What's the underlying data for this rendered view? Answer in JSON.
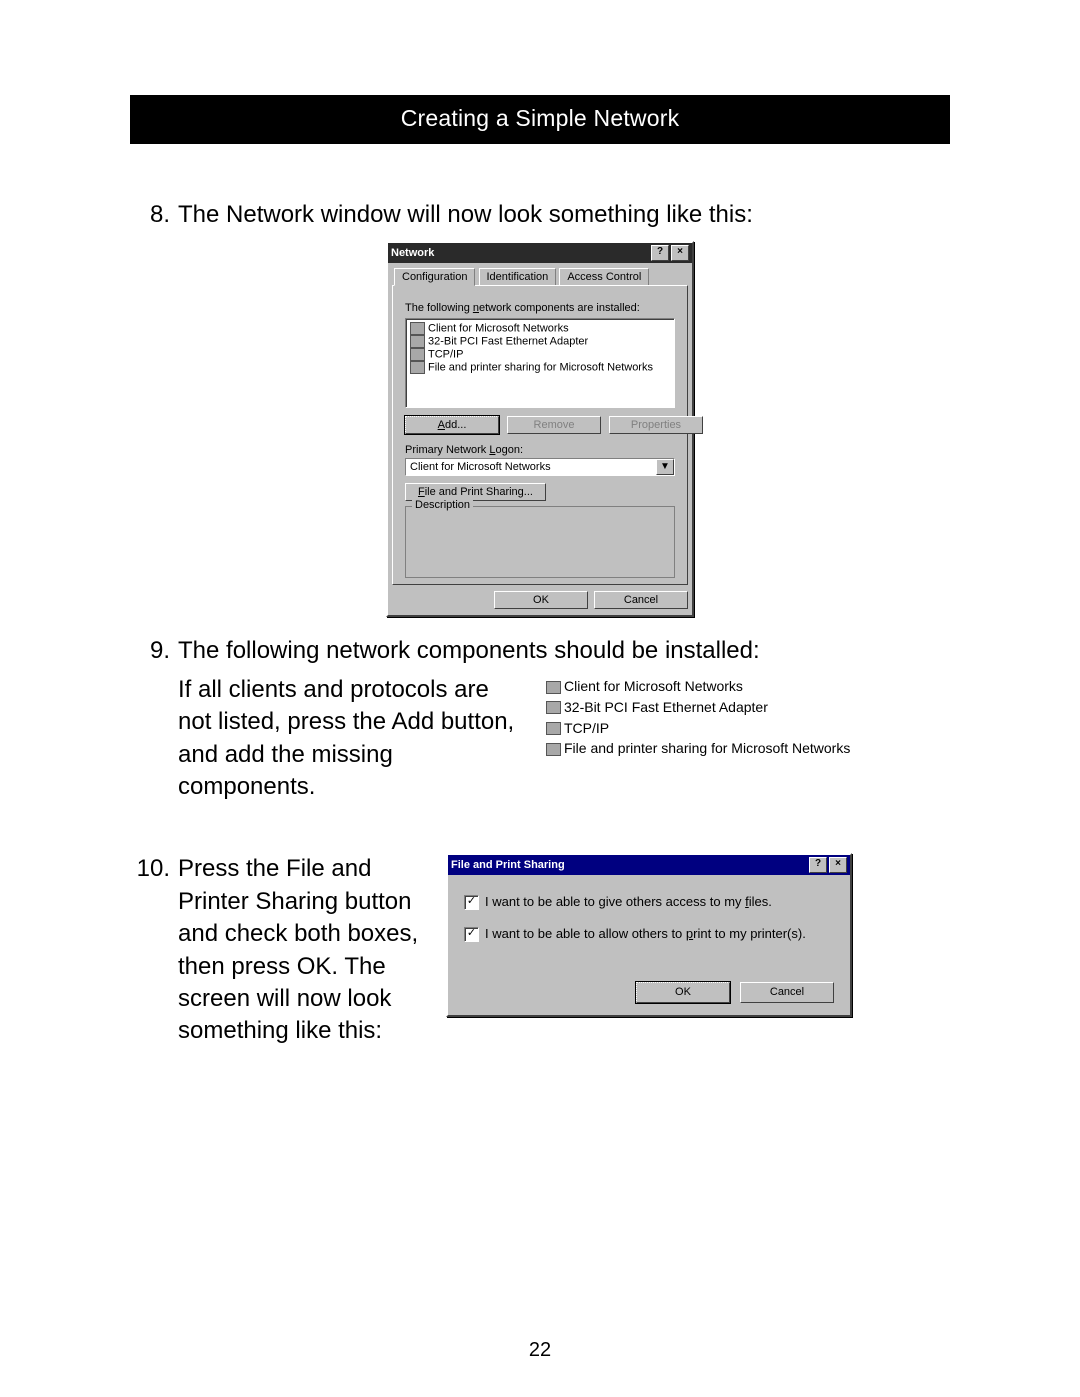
{
  "header": {
    "title": "Creating a Simple Network"
  },
  "page_number": "22",
  "step8": {
    "num": "8.",
    "text": "The Network window will now look something like this:"
  },
  "step9": {
    "num": "9.",
    "line1": "The following network components should be installed:",
    "body": "If all clients and protocols are not listed, press the Add button, and add the missing components."
  },
  "step10": {
    "num": "10.",
    "body": "Press the File and Printer Sharing button and check both boxes, then press OK. The screen will now look something like this:"
  },
  "network_window": {
    "title": "Network",
    "tabs": {
      "configuration": "Configuration",
      "identification": "Identification",
      "access": "Access Control"
    },
    "label_components": "The following network components are installed:",
    "components": {
      "c0": "Client for Microsoft Networks",
      "c1": "32-Bit PCI Fast Ethernet Adapter",
      "c2": "TCP/IP",
      "c3": "File and printer sharing for Microsoft Networks"
    },
    "btn_add": "Add...",
    "btn_remove": "Remove",
    "btn_properties": "Properties",
    "label_logon": "Primary Network Logon:",
    "logon_value": "Client for Microsoft Networks",
    "btn_share": "File and Print Sharing...",
    "group_desc": "Description",
    "btn_ok": "OK",
    "btn_cancel": "Cancel"
  },
  "comp_list": {
    "c0": "Client for Microsoft Networks",
    "c1": "32-Bit PCI Fast Ethernet Adapter",
    "c2": "TCP/IP",
    "c3": "File and printer sharing for Microsoft Networks"
  },
  "share_window": {
    "title": "File and Print Sharing",
    "chk_files": "I want to be able to give others access to my files.",
    "chk_printers": "I want to be able to allow others to print to my printer(s).",
    "btn_ok": "OK",
    "btn_cancel": "Cancel"
  }
}
